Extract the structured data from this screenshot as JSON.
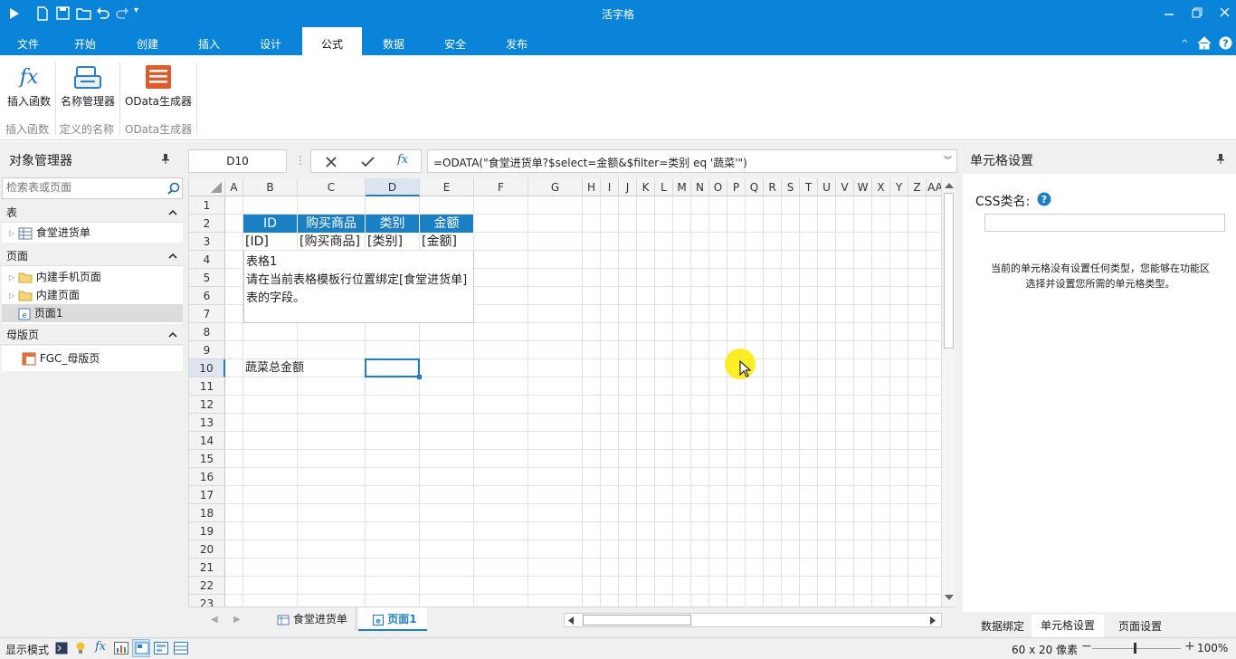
{
  "window": {
    "title": "活字格"
  },
  "ribbon_tabs": [
    "文件",
    "开始",
    "创建",
    "插入",
    "设计",
    "公式",
    "数据",
    "安全",
    "发布"
  ],
  "ribbon_active_index": 5,
  "ribbon": {
    "buttons": [
      {
        "label": "插入函数",
        "icon": "function-icon"
      },
      {
        "label": "名称管理器",
        "icon": "name-manager-icon"
      },
      {
        "label": "OData生成器",
        "icon": "odata-icon"
      }
    ],
    "groups": [
      "插入函数",
      "定义的名称",
      "OData生成器"
    ]
  },
  "object_manager": {
    "title": "对象管理器",
    "search_placeholder": "检索表或页面",
    "sections": [
      {
        "label": "表",
        "items": [
          {
            "label": "食堂进货单",
            "icon": "table-icon"
          }
        ]
      },
      {
        "label": "页面",
        "items": [
          {
            "label": "内建手机页面",
            "icon": "folder-icon"
          },
          {
            "label": "内建页面",
            "icon": "folder-icon"
          },
          {
            "label": "页面1",
            "icon": "page-icon"
          }
        ]
      },
      {
        "label": "母版页",
        "items": [
          {
            "label": "FGC_母版页",
            "icon": "master-page-icon"
          }
        ]
      }
    ]
  },
  "formula_bar": {
    "name_box": "D10",
    "formula": "=ODATA(\"食堂进货单?$select=金额&$filter=类别 eq '蔬菜'\")"
  },
  "grid": {
    "columns": [
      "A",
      "B",
      "C",
      "D",
      "E",
      "F",
      "G",
      "H",
      "I",
      "J",
      "K",
      "L",
      "M",
      "N",
      "O",
      "P",
      "Q",
      "R",
      "S",
      "T",
      "U",
      "V",
      "W",
      "X",
      "Y",
      "Z",
      "AA"
    ],
    "rows": [
      "1",
      "2",
      "3",
      "4",
      "5",
      "6",
      "7",
      "8",
      "9",
      "10",
      "11",
      "12",
      "13",
      "14",
      "15",
      "16",
      "17",
      "18",
      "19",
      "20",
      "21",
      "22",
      "23"
    ],
    "selected_cell": "D10",
    "table_header": [
      "ID",
      "购买商品",
      "类别",
      "金额"
    ],
    "table_template": [
      "[ID]",
      "[购买商品]",
      "[类别]",
      "[金额]"
    ],
    "table_note_title": "表格1",
    "table_note_text": "请在当前表格模板行位置绑定[食堂进货单]表的字段。",
    "b10_text": "蔬菜总金额"
  },
  "sheet_tabs": [
    "食堂进货单",
    "页面1"
  ],
  "active_sheet_tab": "页面1",
  "right_panel": {
    "title": "单元格设置",
    "css_label": "CSS类名:",
    "css_value": "",
    "info": "当前的单元格没有设置任何类型，您能够在功能区选择并设置您所需的单元格类型。",
    "tabs": [
      "数据绑定",
      "单元格设置",
      "页面设置"
    ],
    "active_tab": "单元格设置"
  },
  "status": {
    "mode": "显示模式",
    "grid_size": "60 x 20 像素",
    "zoom": "100%"
  },
  "colors": {
    "accent": "#0a84d8",
    "table_header": "#1b7fc4"
  }
}
